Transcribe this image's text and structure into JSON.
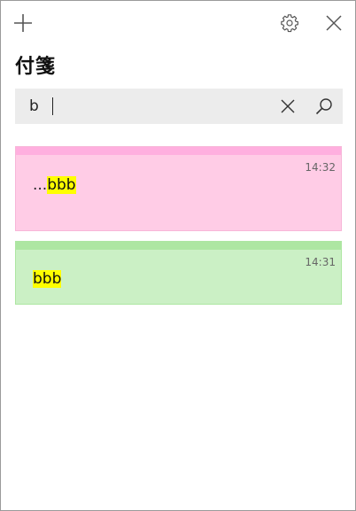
{
  "app": {
    "title": "付箋"
  },
  "toolbar": {
    "add_icon": "plus-icon",
    "settings_icon": "gear-icon",
    "close_icon": "close-icon"
  },
  "search": {
    "value": "b",
    "clear_icon": "close-icon",
    "search_icon": "search-icon"
  },
  "notes": [
    {
      "time": "14:32",
      "prefix": "...",
      "highlight": "bbb",
      "color": "#ffcce6",
      "accent": "#ffafdf"
    },
    {
      "time": "14:31",
      "prefix": "",
      "highlight": "bbb",
      "color": "#cbf0c5",
      "accent": "#ade6a2"
    }
  ],
  "highlight_color": "#ffff00"
}
